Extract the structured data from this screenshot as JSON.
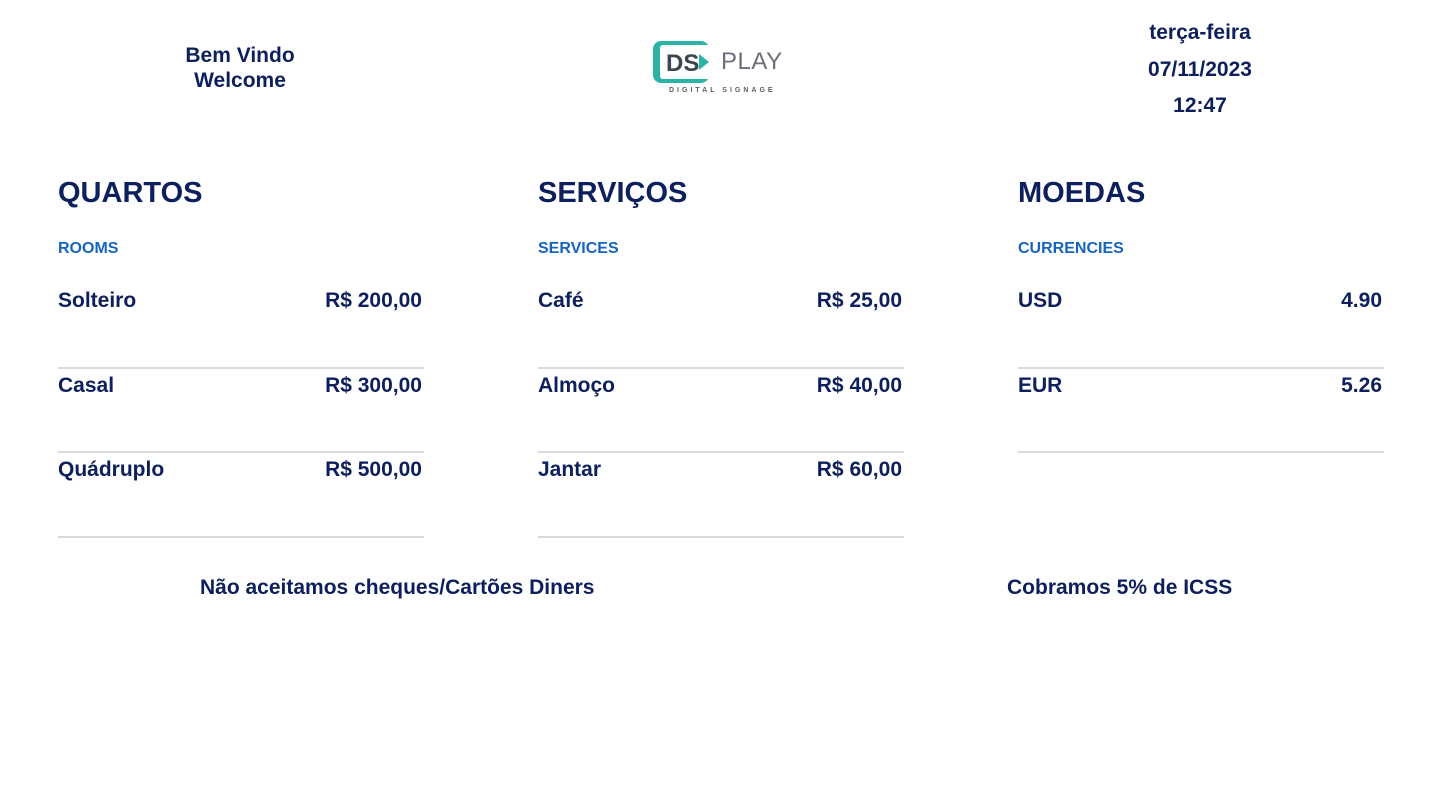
{
  "header": {
    "welcome_pt": "Bem Vindo",
    "welcome_en": "Welcome",
    "logo": {
      "mark_text": "DS",
      "play_text": "PLAY",
      "subtitle": "DIGITAL SIGNAGE",
      "colors": {
        "teal": "#2bb3a3",
        "dark": "#3c4450",
        "gray": "#6b6f7a"
      }
    },
    "weekday": "terça-feira",
    "date": "07/11/2023",
    "time": "12:47"
  },
  "sections": [
    {
      "title": "QUARTOS",
      "subtitle": "ROOMS",
      "rows": [
        {
          "label": "Solteiro",
          "value": "R$ 200,00"
        },
        {
          "label": "Casal",
          "value": "R$ 300,00"
        },
        {
          "label": "Quádruplo",
          "value": "R$ 500,00"
        }
      ]
    },
    {
      "title": "SERVIÇOS",
      "subtitle": "SERVICES",
      "rows": [
        {
          "label": "Café",
          "value": "R$ 25,00"
        },
        {
          "label": "Almoço",
          "value": "R$ 40,00"
        },
        {
          "label": "Jantar",
          "value": "R$ 60,00"
        }
      ]
    },
    {
      "title": "MOEDAS",
      "subtitle": "CURRENCIES",
      "rows": [
        {
          "label": "USD",
          "value": "4.90"
        },
        {
          "label": "EUR",
          "value": "5.26"
        }
      ]
    }
  ],
  "footer": {
    "note_left": "Não aceitamos cheques/Cartões Diners",
    "note_right": "Cobramos 5% de ICSS"
  },
  "colors": {
    "primary_text": "#0d1f5c",
    "subtitle_blue": "#1565c0",
    "divider": "#d9d9d9",
    "background": "#ffffff"
  }
}
